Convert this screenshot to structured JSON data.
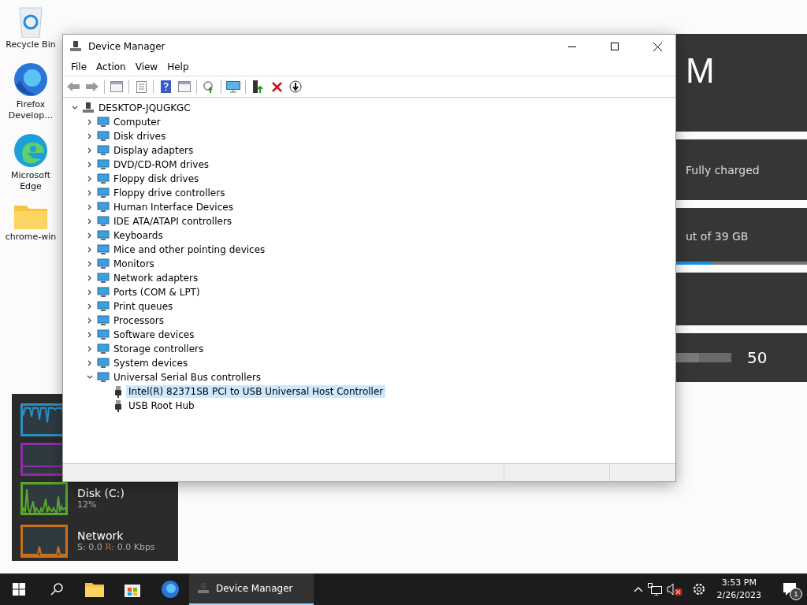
{
  "desktop_icons": [
    {
      "label": "Recycle Bin"
    },
    {
      "label": "Firefox Develop…"
    },
    {
      "label": "Microsoft Edge"
    },
    {
      "label": "chrome-win"
    }
  ],
  "settings_panel": {
    "heading": "M",
    "battery_status": "Fully charged",
    "storage_text": "ut of 39 GB",
    "storage_bar": {
      "level": 0.28
    },
    "slider": {
      "level": 0.42
    },
    "slider_value": "50"
  },
  "performance_widget": {
    "graphs": [
      {
        "color": "#2a8fc4"
      },
      {
        "color": "#8c2fa8"
      },
      {
        "color": "#58a82a",
        "label": "Disk (C:)",
        "value": "12%"
      },
      {
        "color": "#c8701e",
        "label": "Network",
        "send": "S: 0.0",
        "receive_label": "R:",
        "receive": "0.0 Kbps"
      }
    ]
  },
  "window": {
    "title": "Device Manager",
    "menu": [
      "File",
      "Action",
      "View",
      "Help"
    ],
    "tree": {
      "label": "DESKTOP-JQUGKGC",
      "expanded": true,
      "children": [
        {
          "label": "Computer",
          "expanded": false
        },
        {
          "label": "Disk drives",
          "expanded": false
        },
        {
          "label": "Display adapters",
          "expanded": false
        },
        {
          "label": "DVD/CD-ROM drives",
          "expanded": false
        },
        {
          "label": "Floppy disk drives",
          "expanded": false
        },
        {
          "label": "Floppy drive controllers",
          "expanded": false
        },
        {
          "label": "Human Interface Devices",
          "expanded": false
        },
        {
          "label": "IDE ATA/ATAPI controllers",
          "expanded": false
        },
        {
          "label": "Keyboards",
          "expanded": false
        },
        {
          "label": "Mice and other pointing devices",
          "expanded": false
        },
        {
          "label": "Monitors",
          "expanded": false
        },
        {
          "label": "Network adapters",
          "expanded": false
        },
        {
          "label": "Ports (COM & LPT)",
          "expanded": false
        },
        {
          "label": "Print queues",
          "expanded": false
        },
        {
          "label": "Processors",
          "expanded": false
        },
        {
          "label": "Software devices",
          "expanded": false
        },
        {
          "label": "Storage controllers",
          "expanded": false
        },
        {
          "label": "System devices",
          "expanded": false
        },
        {
          "label": "Universal Serial Bus controllers",
          "expanded": true,
          "children": [
            {
              "label": "Intel(R) 82371SB PCI to USB Universal Host Controller",
              "selected": true
            },
            {
              "label": "USB Root Hub",
              "selected": false
            }
          ]
        }
      ]
    }
  },
  "taskbar": {
    "active_task": "Device Manager",
    "time": "3:53 PM",
    "date": "2/26/2023",
    "notification_count": "1"
  }
}
